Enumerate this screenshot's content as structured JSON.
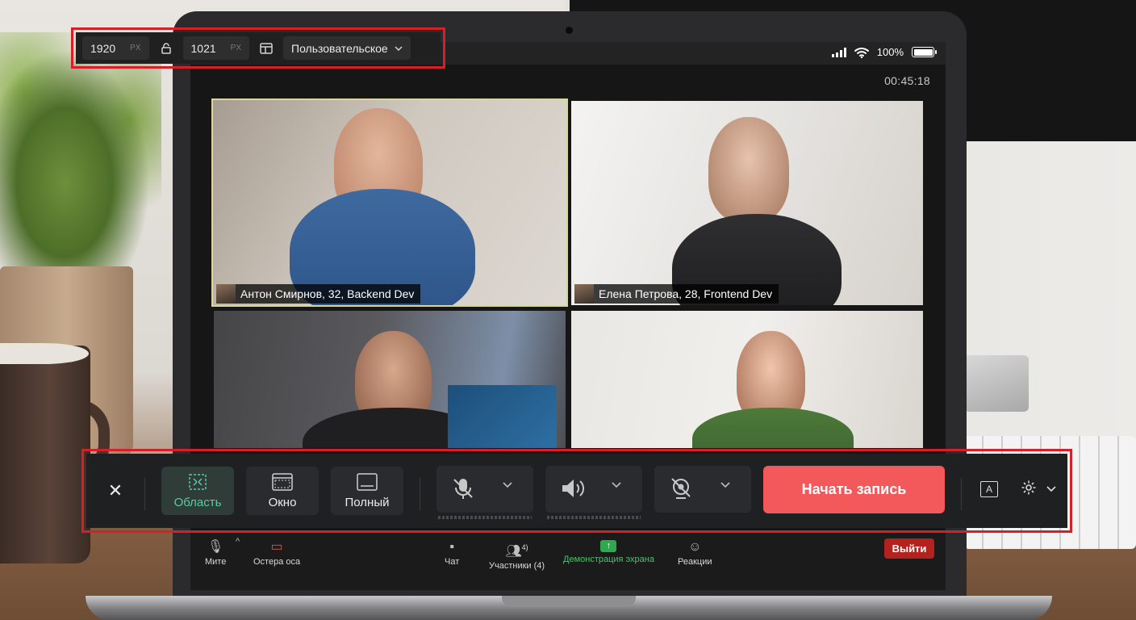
{
  "top_toolbar": {
    "width_value": "1920",
    "width_unit": "PX",
    "height_value": "1021",
    "height_unit": "PX",
    "preset_label": "Пользовательское",
    "icons": [
      "lock-icon",
      "layout-icon",
      "chevron-down-icon"
    ]
  },
  "device_status": {
    "battery": "100%",
    "battery_level": 1.0,
    "icons": [
      "signal-icon",
      "wifi-icon",
      "battery-icon"
    ]
  },
  "meeting": {
    "timer": "00:45:18",
    "participants": [
      {
        "label": "Антон Смирнов, 32, Backend Dev",
        "active_speaker": true
      },
      {
        "label": "Елена Петрова, 28, Frontend Dev",
        "active_speaker": false
      },
      {
        "label": "",
        "active_speaker": false
      },
      {
        "label": "",
        "active_speaker": false
      }
    ],
    "bottom_bar": {
      "mute": "Мите",
      "video": "Остера оса",
      "chat": "Чат",
      "participants": "Участники (4)",
      "participants_badge": "4)",
      "share": "Демонстрация эхрана",
      "reactions": "Реакции",
      "leave": "Выйти"
    }
  },
  "recorder_toolbar": {
    "modes": [
      {
        "label": "Область",
        "icon": "region-select-icon",
        "active": true
      },
      {
        "label": "Окно",
        "icon": "window-icon",
        "active": false
      },
      {
        "label": "Полный",
        "icon": "fullscreen-icon",
        "active": false
      }
    ],
    "devices": [
      {
        "name": "microphone",
        "icon": "microphone-muted-icon"
      },
      {
        "name": "system-audio",
        "icon": "speaker-icon"
      },
      {
        "name": "camera",
        "icon": "camera-off-icon"
      }
    ],
    "start_label": "Начать запись",
    "right_icons": [
      "text-annotation-icon",
      "settings-icon",
      "chevron-down-icon"
    ],
    "accent_color": "#f3585b",
    "active_mode_color": "#5cc9a9"
  }
}
